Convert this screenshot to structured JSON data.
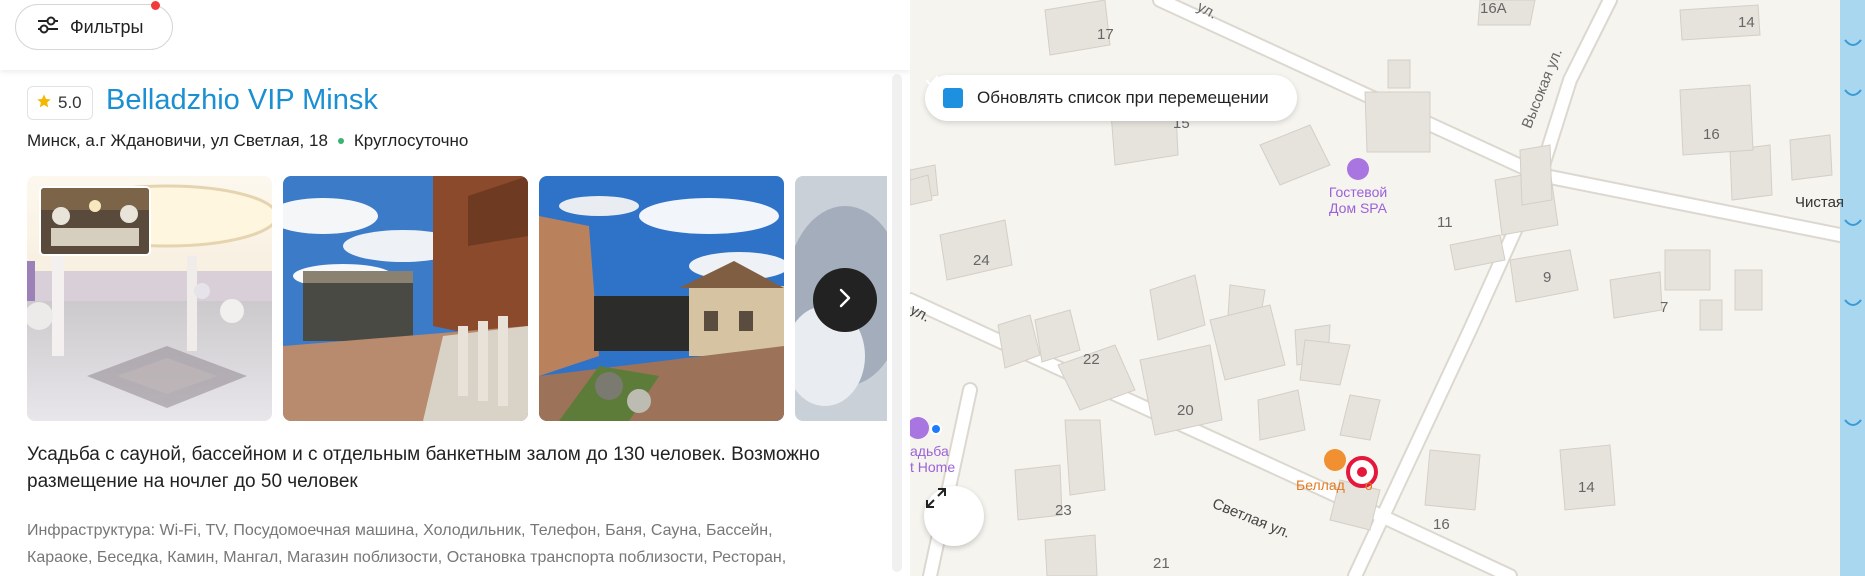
{
  "toolbar": {
    "filters_label": "Фильтры",
    "filters_icon": "sliders-icon",
    "filters_badge_color": "#f33a3a"
  },
  "listing": {
    "rating": "5.0",
    "title": "Belladzhio VIP Minsk",
    "address": "Минск, а.г Ждановичи, ул Светлая, 18",
    "hours": "Круглосуточно",
    "description": "Усадьба с сауной, бассейном и с отдельным банкетным залом до 130 человек. Возможно размещение на ночлег до 50 человек",
    "infrastructure_1": "Инфраструктура: Wi-Fi, TV, Посудомоечная машина, Холодильник, Телефон, Баня, Сауна, Бассейн,",
    "infrastructure_2": "Караоке, Беседка, Камин, Мангал, Магазин поблизости, Остановка транспорта поблизости, Ресторан,"
  },
  "map": {
    "update_on_move_label": "Обновлять список при перемещении",
    "update_on_move_checked": true,
    "streets": {
      "svetlaya": "Светлая ул.",
      "vysokaya": "Высокая ул.",
      "chistaya": "Чистая",
      "ul_top": "ул.",
      "ul_left": "ул."
    },
    "houses": {
      "h17": "17",
      "h16a": "16А",
      "h14a": "14",
      "h15": "15",
      "h16": "16",
      "h11": "11",
      "h24": "24",
      "h9": "9",
      "h7": "7",
      "h22": "22",
      "h20": "20",
      "h23": "23",
      "h14b": "14",
      "h16b": "16",
      "h21": "21"
    },
    "poi_spa_1": "Гостевой",
    "poi_spa_2": "Дом SPA",
    "poi_home_1": "адьба",
    "poi_home_2": "t Home",
    "poi_bella": "Беллад",
    "poi_bella_tail": "о"
  }
}
